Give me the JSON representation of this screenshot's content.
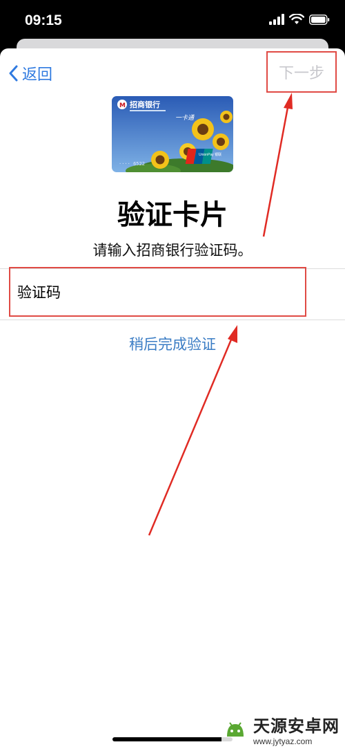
{
  "status_bar": {
    "time": "09:15",
    "icons": [
      "signal-icon",
      "wifi-icon",
      "battery-icon"
    ]
  },
  "nav": {
    "back_label": "返回",
    "next_label": "下一步",
    "accent_color": "#2f7ae0",
    "disabled_color": "#c7c7cc"
  },
  "card": {
    "bank_name": "招商银行",
    "card_type": "一卡通",
    "card_number_tail": "···· 6522",
    "network_logo": "UnionPay 银联"
  },
  "main": {
    "title": "验证卡片",
    "subtitle": "请输入招商银行验证码。",
    "code_field_label": "验证码",
    "later_link": "稍后完成验证"
  },
  "annotations": {
    "highlight_color": "#e04a44"
  },
  "watermark": {
    "name": "天源安卓网",
    "url": "www.jytyaz.com"
  }
}
